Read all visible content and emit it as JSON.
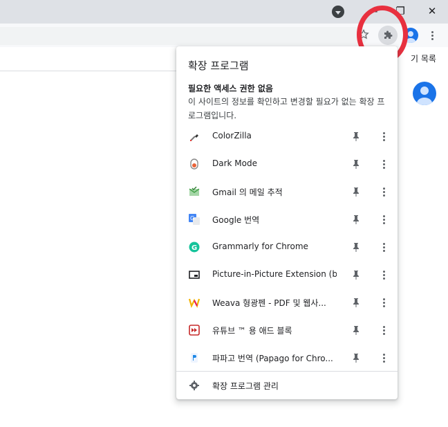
{
  "window": {
    "minimize_label": "—",
    "maximize_label": "❐",
    "close_label": "✕"
  },
  "toolbar": {
    "reading_list_label": "기 목록",
    "close_label": "✕"
  },
  "popup": {
    "title": "확장 프로그램",
    "section_heading": "필요한 액세스 권한 없음",
    "section_description": "이 사이트의 정보를 확인하고 변경할 필요가 없는 확장 프로그램입니다.",
    "extensions": [
      {
        "name": "ColorZilla",
        "icon": "colorzilla-icon"
      },
      {
        "name": "Dark Mode",
        "icon": "dark-mode-icon"
      },
      {
        "name": "Gmail 의 메일 추적",
        "icon": "gmail-tracker-icon"
      },
      {
        "name": "Google 번역",
        "icon": "google-translate-icon"
      },
      {
        "name": "Grammarly for Chrome",
        "icon": "grammarly-icon"
      },
      {
        "name": "Picture-in-Picture Extension (b...",
        "icon": "pip-icon"
      },
      {
        "name": "Weava 형광펜 - PDF 및 웹사...",
        "icon": "weava-icon"
      },
      {
        "name": "유튜브 ™ 용 애드 블록",
        "icon": "youtube-adblock-icon"
      },
      {
        "name": "파파고 번역 (Papago for Chro...",
        "icon": "papago-icon"
      }
    ],
    "manage_label": "확장 프로그램 관리"
  },
  "colors": {
    "highlight_ring": "#e8303f",
    "accent_blue": "#1a73e8"
  }
}
